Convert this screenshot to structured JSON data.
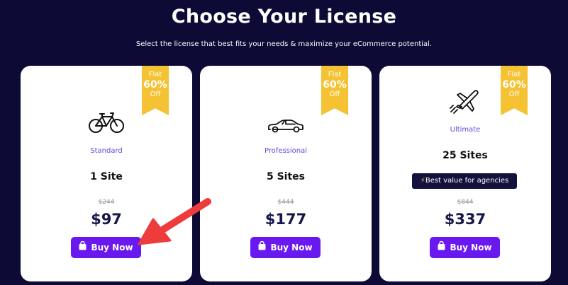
{
  "header": {
    "title": "Choose Your License",
    "subtitle": "Select the license that best fits your needs & maximize your eCommerce potential."
  },
  "ribbon": {
    "flat": "Flat",
    "percent": "60%",
    "off": "Off"
  },
  "cards": [
    {
      "plan": "Standard",
      "sites": "1 Site",
      "old_price": "$244",
      "price": "$97",
      "button": "Buy Now",
      "icon": "bicycle-icon"
    },
    {
      "plan": "Professional",
      "sites": "5 Sites",
      "old_price": "$444",
      "price": "$177",
      "button": "Buy Now",
      "icon": "car-icon"
    },
    {
      "plan": "Ultimate",
      "sites": "25 Sites",
      "badge": "Best value for agencies",
      "old_price": "$844",
      "price": "$337",
      "button": "Buy Now",
      "icon": "airplane-icon"
    }
  ],
  "colors": {
    "background": "#0d0b35",
    "ribbon": "#f5c234",
    "button": "#6a18f0",
    "plan_text": "#5b4ed6",
    "price_text": "#17184a",
    "arrow": "#ee3b3b"
  }
}
